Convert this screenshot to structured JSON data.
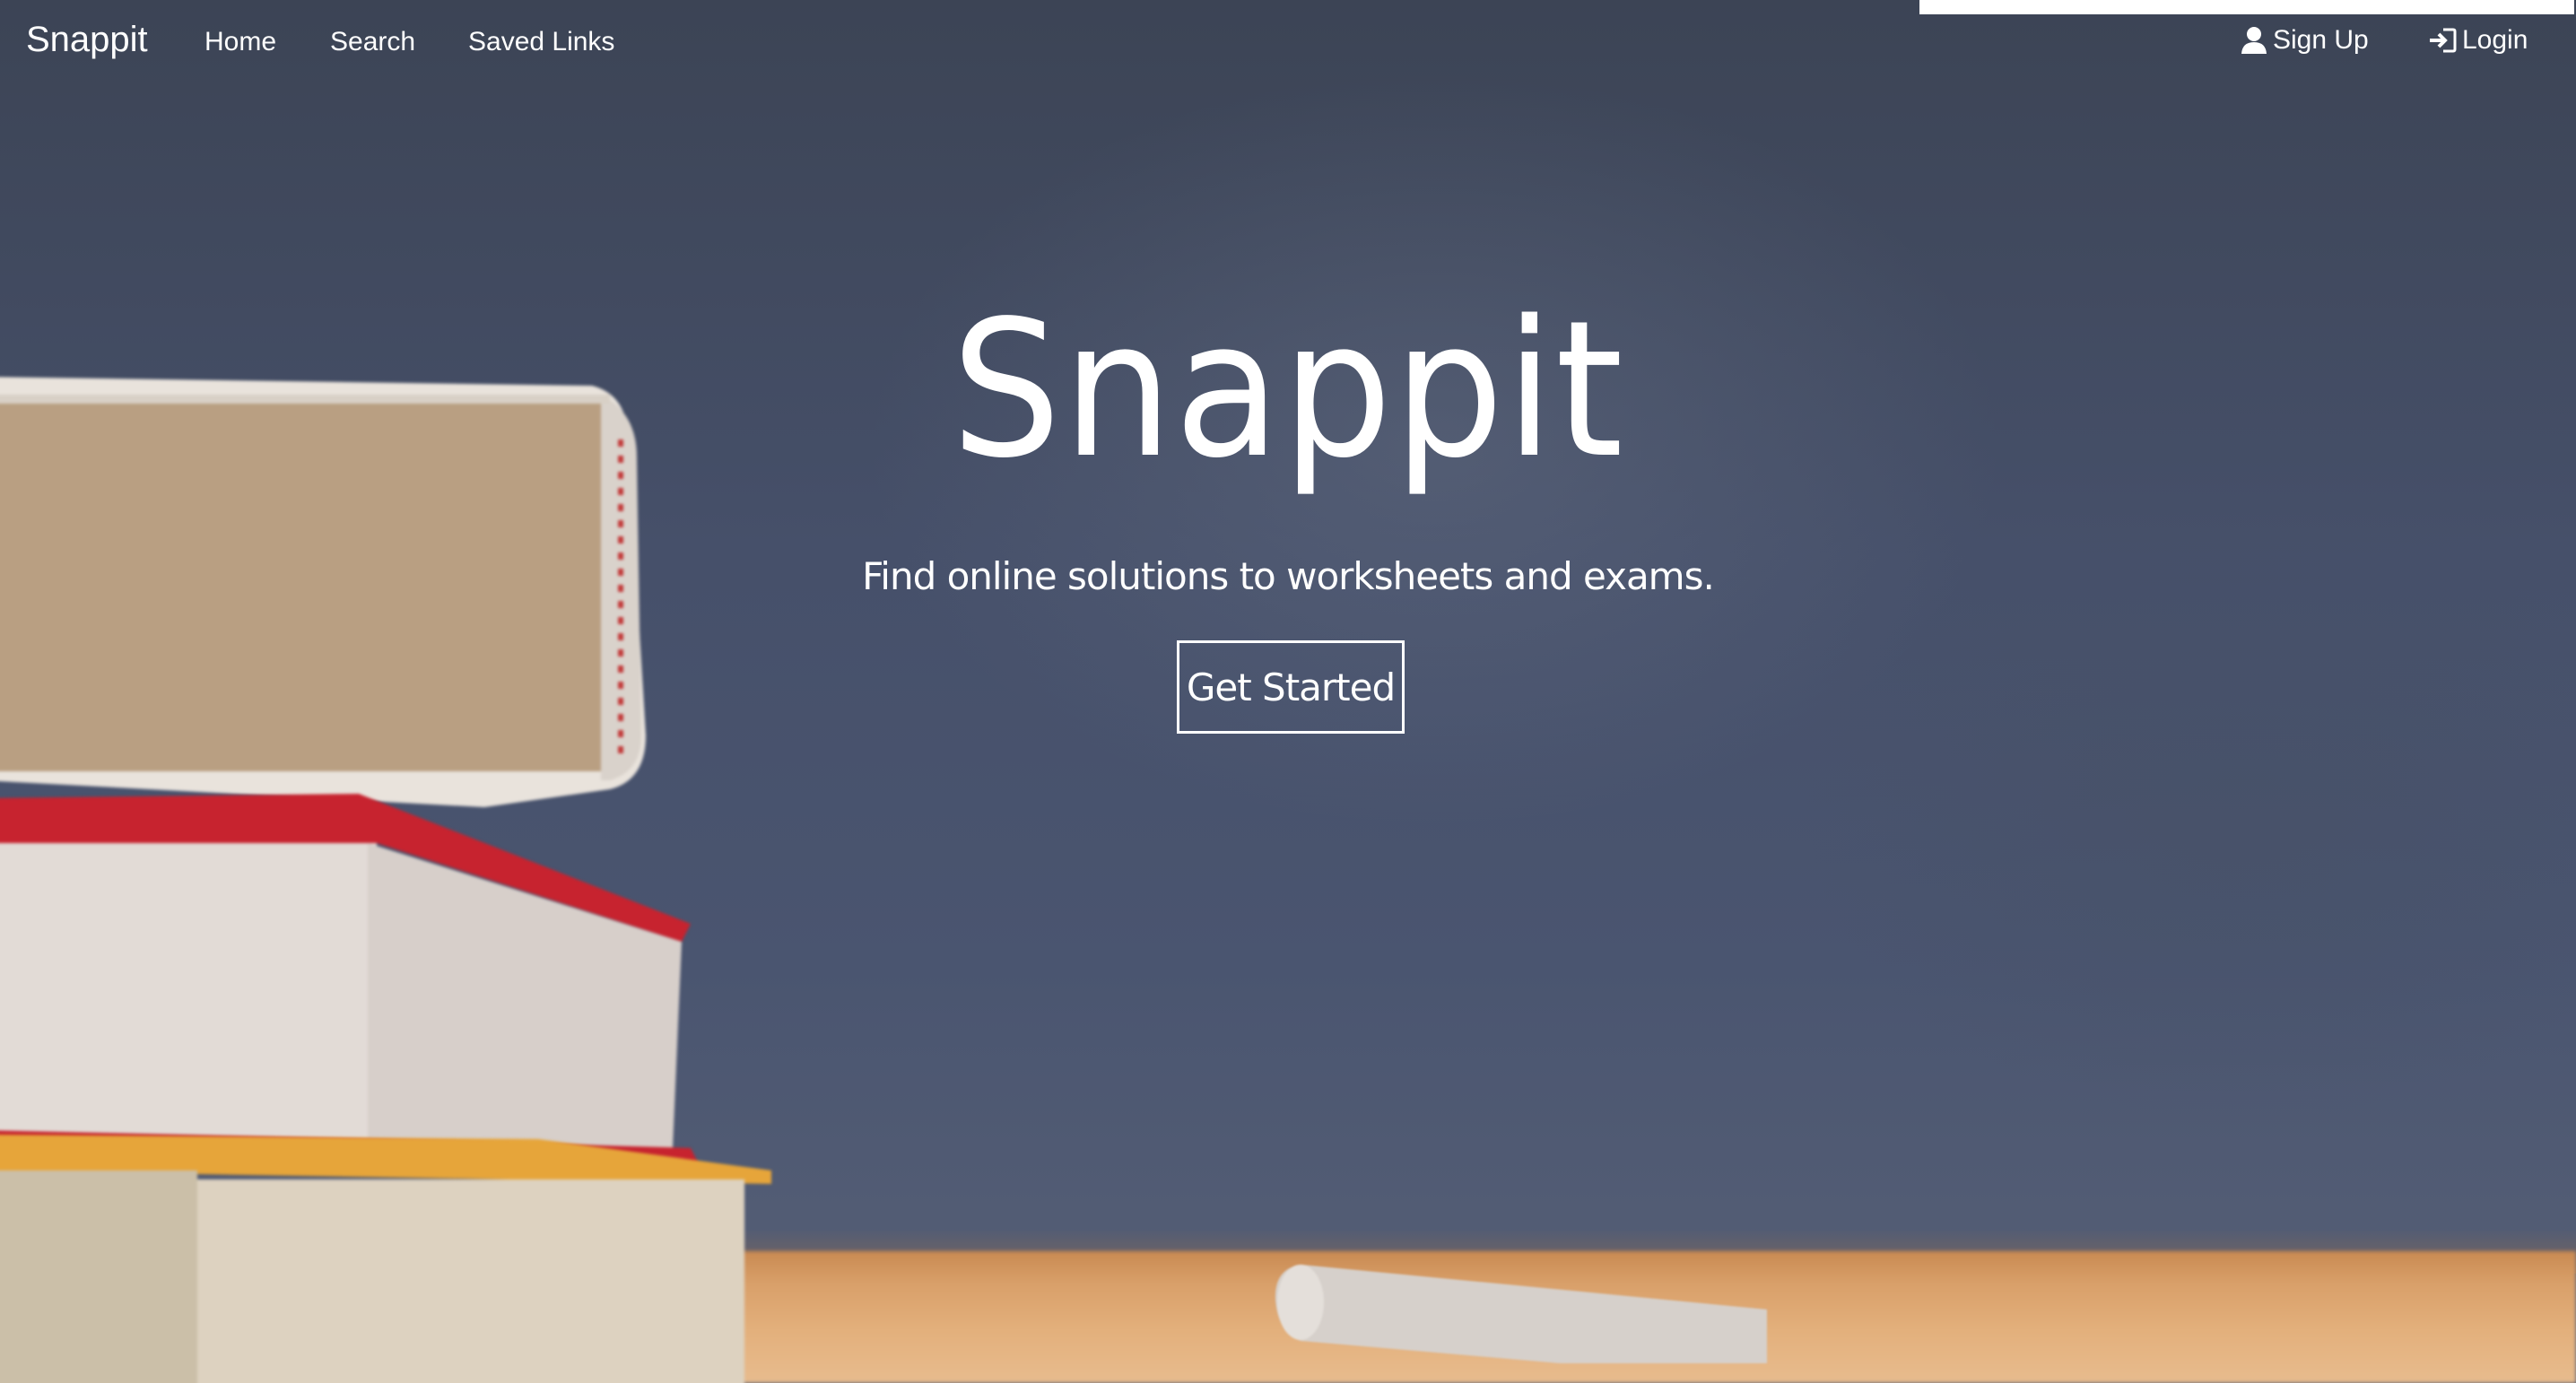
{
  "navbar": {
    "brand": "Snappit",
    "links": {
      "home": "Home",
      "search": "Search",
      "saved_links": "Saved Links"
    },
    "signup_label": "Sign Up",
    "login_label": "Login",
    "signup_icon": "user-icon",
    "login_icon": "login-icon"
  },
  "hero": {
    "title": "Snappit",
    "subtitle": "Find online solutions to worksheets and exams.",
    "cta_label": "Get Started"
  },
  "colors": {
    "text": "#ffffff",
    "chalkboard": "#46506a",
    "desk": "#d9a06a"
  }
}
